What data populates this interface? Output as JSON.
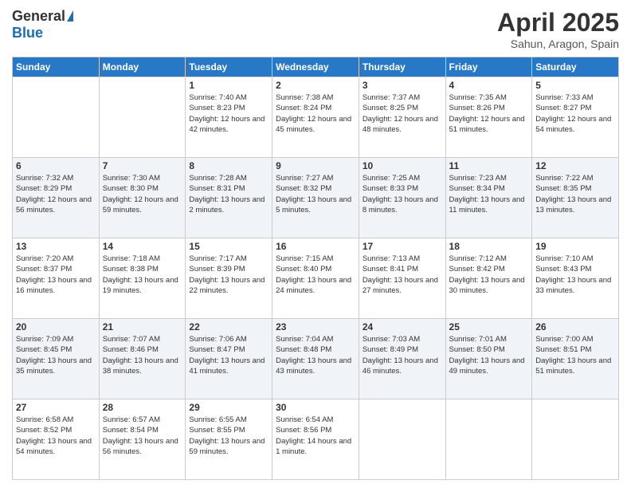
{
  "header": {
    "logo_general": "General",
    "logo_blue": "Blue",
    "month_title": "April 2025",
    "location": "Sahun, Aragon, Spain"
  },
  "days_of_week": [
    "Sunday",
    "Monday",
    "Tuesday",
    "Wednesday",
    "Thursday",
    "Friday",
    "Saturday"
  ],
  "weeks": [
    [
      {
        "day": "",
        "info": ""
      },
      {
        "day": "",
        "info": ""
      },
      {
        "day": "1",
        "info": "Sunrise: 7:40 AM\nSunset: 8:23 PM\nDaylight: 12 hours and 42 minutes."
      },
      {
        "day": "2",
        "info": "Sunrise: 7:38 AM\nSunset: 8:24 PM\nDaylight: 12 hours and 45 minutes."
      },
      {
        "day": "3",
        "info": "Sunrise: 7:37 AM\nSunset: 8:25 PM\nDaylight: 12 hours and 48 minutes."
      },
      {
        "day": "4",
        "info": "Sunrise: 7:35 AM\nSunset: 8:26 PM\nDaylight: 12 hours and 51 minutes."
      },
      {
        "day": "5",
        "info": "Sunrise: 7:33 AM\nSunset: 8:27 PM\nDaylight: 12 hours and 54 minutes."
      }
    ],
    [
      {
        "day": "6",
        "info": "Sunrise: 7:32 AM\nSunset: 8:29 PM\nDaylight: 12 hours and 56 minutes."
      },
      {
        "day": "7",
        "info": "Sunrise: 7:30 AM\nSunset: 8:30 PM\nDaylight: 12 hours and 59 minutes."
      },
      {
        "day": "8",
        "info": "Sunrise: 7:28 AM\nSunset: 8:31 PM\nDaylight: 13 hours and 2 minutes."
      },
      {
        "day": "9",
        "info": "Sunrise: 7:27 AM\nSunset: 8:32 PM\nDaylight: 13 hours and 5 minutes."
      },
      {
        "day": "10",
        "info": "Sunrise: 7:25 AM\nSunset: 8:33 PM\nDaylight: 13 hours and 8 minutes."
      },
      {
        "day": "11",
        "info": "Sunrise: 7:23 AM\nSunset: 8:34 PM\nDaylight: 13 hours and 11 minutes."
      },
      {
        "day": "12",
        "info": "Sunrise: 7:22 AM\nSunset: 8:35 PM\nDaylight: 13 hours and 13 minutes."
      }
    ],
    [
      {
        "day": "13",
        "info": "Sunrise: 7:20 AM\nSunset: 8:37 PM\nDaylight: 13 hours and 16 minutes."
      },
      {
        "day": "14",
        "info": "Sunrise: 7:18 AM\nSunset: 8:38 PM\nDaylight: 13 hours and 19 minutes."
      },
      {
        "day": "15",
        "info": "Sunrise: 7:17 AM\nSunset: 8:39 PM\nDaylight: 13 hours and 22 minutes."
      },
      {
        "day": "16",
        "info": "Sunrise: 7:15 AM\nSunset: 8:40 PM\nDaylight: 13 hours and 24 minutes."
      },
      {
        "day": "17",
        "info": "Sunrise: 7:13 AM\nSunset: 8:41 PM\nDaylight: 13 hours and 27 minutes."
      },
      {
        "day": "18",
        "info": "Sunrise: 7:12 AM\nSunset: 8:42 PM\nDaylight: 13 hours and 30 minutes."
      },
      {
        "day": "19",
        "info": "Sunrise: 7:10 AM\nSunset: 8:43 PM\nDaylight: 13 hours and 33 minutes."
      }
    ],
    [
      {
        "day": "20",
        "info": "Sunrise: 7:09 AM\nSunset: 8:45 PM\nDaylight: 13 hours and 35 minutes."
      },
      {
        "day": "21",
        "info": "Sunrise: 7:07 AM\nSunset: 8:46 PM\nDaylight: 13 hours and 38 minutes."
      },
      {
        "day": "22",
        "info": "Sunrise: 7:06 AM\nSunset: 8:47 PM\nDaylight: 13 hours and 41 minutes."
      },
      {
        "day": "23",
        "info": "Sunrise: 7:04 AM\nSunset: 8:48 PM\nDaylight: 13 hours and 43 minutes."
      },
      {
        "day": "24",
        "info": "Sunrise: 7:03 AM\nSunset: 8:49 PM\nDaylight: 13 hours and 46 minutes."
      },
      {
        "day": "25",
        "info": "Sunrise: 7:01 AM\nSunset: 8:50 PM\nDaylight: 13 hours and 49 minutes."
      },
      {
        "day": "26",
        "info": "Sunrise: 7:00 AM\nSunset: 8:51 PM\nDaylight: 13 hours and 51 minutes."
      }
    ],
    [
      {
        "day": "27",
        "info": "Sunrise: 6:58 AM\nSunset: 8:52 PM\nDaylight: 13 hours and 54 minutes."
      },
      {
        "day": "28",
        "info": "Sunrise: 6:57 AM\nSunset: 8:54 PM\nDaylight: 13 hours and 56 minutes."
      },
      {
        "day": "29",
        "info": "Sunrise: 6:55 AM\nSunset: 8:55 PM\nDaylight: 13 hours and 59 minutes."
      },
      {
        "day": "30",
        "info": "Sunrise: 6:54 AM\nSunset: 8:56 PM\nDaylight: 14 hours and 1 minute."
      },
      {
        "day": "",
        "info": ""
      },
      {
        "day": "",
        "info": ""
      },
      {
        "day": "",
        "info": ""
      }
    ]
  ]
}
